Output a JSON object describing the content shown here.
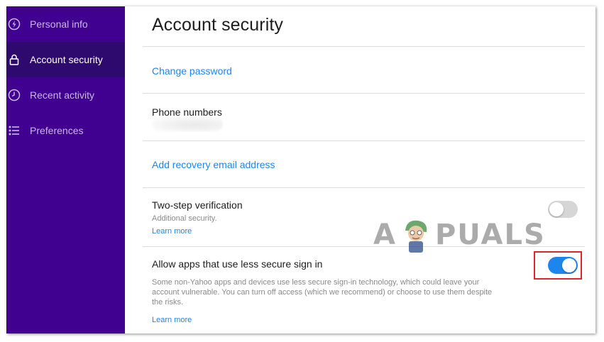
{
  "sidebar": {
    "items": [
      {
        "label": "Personal info",
        "icon": "personal-info-icon"
      },
      {
        "label": "Account security",
        "icon": "lock-icon",
        "active": true
      },
      {
        "label": "Recent activity",
        "icon": "clock-icon"
      },
      {
        "label": "Preferences",
        "icon": "list-icon"
      }
    ],
    "background": "#400090",
    "active_background": "#2f0a6e"
  },
  "main": {
    "title": "Account security",
    "change_password": "Change password",
    "phone": {
      "title": "Phone numbers"
    },
    "recovery_email": "Add recovery email address",
    "two_step": {
      "title": "Two-step verification",
      "subtitle": "Additional security.",
      "learn_more": "Learn more",
      "enabled": false
    },
    "less_secure": {
      "title": "Allow apps that use less secure sign in",
      "description": "Some non-Yahoo apps and devices use less secure sign-in technology, which could leave your account vulnerable. You can turn off access (which we recommend) or choose to use them despite the risks.",
      "learn_more": "Learn more",
      "enabled": true
    }
  },
  "watermark": {
    "left": "A",
    "right": "PUALS"
  },
  "colors": {
    "accent": "#1c86ee",
    "highlight": "#e0242b"
  }
}
